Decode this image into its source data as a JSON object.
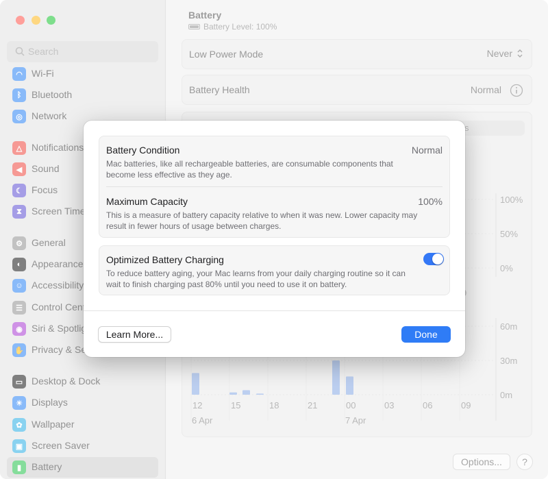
{
  "window": {
    "traffic_lights": [
      {
        "name": "close",
        "color": "#ff5f57"
      },
      {
        "name": "minimize",
        "color": "#febc2e"
      },
      {
        "name": "zoom",
        "color": "#28c840"
      }
    ]
  },
  "sidebar": {
    "search_placeholder": "Search",
    "items": [
      {
        "label": "Wi-Fi",
        "icon": "wifi-icon",
        "color": "#3b8cf5"
      },
      {
        "label": "Bluetooth",
        "icon": "bluetooth-icon",
        "color": "#3b8cf5"
      },
      {
        "label": "Network",
        "icon": "globe-icon",
        "color": "#3b8cf5"
      },
      {
        "label": "Notifications",
        "icon": "bell-icon",
        "color": "#f0564d"
      },
      {
        "label": "Sound",
        "icon": "speaker-icon",
        "color": "#f0564d"
      },
      {
        "label": "Focus",
        "icon": "moon-icon",
        "color": "#6a5cd6"
      },
      {
        "label": "Screen Time",
        "icon": "hourglass-icon",
        "color": "#6a5cd6"
      },
      {
        "label": "General",
        "icon": "gear-icon",
        "color": "#9a9a9a"
      },
      {
        "label": "Appearance",
        "icon": "appearance-icon",
        "color": "#2a2a2a"
      },
      {
        "label": "Accessibility",
        "icon": "accessibility-icon",
        "color": "#3b8cf5"
      },
      {
        "label": "Control Centre",
        "icon": "control-centre-icon",
        "color": "#9a9a9a"
      },
      {
        "label": "Siri & Spotlight",
        "icon": "siri-icon",
        "color": "#b04ad6"
      },
      {
        "label": "Privacy & Security",
        "icon": "hand-icon",
        "color": "#3b8cf5"
      },
      {
        "label": "Desktop & Dock",
        "icon": "dock-icon",
        "color": "#2a2a2a"
      },
      {
        "label": "Displays",
        "icon": "sun-icon",
        "color": "#3b8cf5"
      },
      {
        "label": "Wallpaper",
        "icon": "flower-icon",
        "color": "#3bb5e6"
      },
      {
        "label": "Screen Saver",
        "icon": "screen-saver-icon",
        "color": "#3bb5e6"
      },
      {
        "label": "Battery",
        "icon": "battery-icon",
        "color": "#34c759",
        "selected": true
      }
    ]
  },
  "main": {
    "title": "Battery",
    "battery_level": "Battery Level: 100%",
    "low_power_mode": {
      "label": "Low Power Mode",
      "value": "Never"
    },
    "battery_health": {
      "label": "Battery Health",
      "value": "Normal"
    },
    "segment_partial": "s",
    "options_label": "Options...",
    "help_label": "?"
  },
  "chart_data": [
    {
      "type": "line",
      "title": "",
      "y_tick_labels": [
        "100%",
        "50%",
        "0%"
      ],
      "ylim": [
        0,
        100
      ],
      "x_tick_labels": [
        "9"
      ],
      "values": []
    },
    {
      "type": "bar",
      "title": "",
      "y_tick_labels": [
        "60m",
        "30m",
        "0m"
      ],
      "ylim": [
        0,
        60
      ],
      "x_tick_labels": [
        "12",
        "15",
        "18",
        "21",
        "00",
        "03",
        "06",
        "09"
      ],
      "date_labels": [
        "6 Apr",
        "7 Apr"
      ],
      "values_minutes": [
        {
          "x": "12",
          "v": 19
        },
        {
          "x": "15a",
          "v": 2
        },
        {
          "x": "15b",
          "v": 4
        },
        {
          "x": "18",
          "v": 1
        },
        {
          "x": "00a",
          "v": 30
        },
        {
          "x": "00b",
          "v": 16
        }
      ]
    }
  ],
  "sheet": {
    "battery_condition": {
      "title": "Battery Condition",
      "value": "Normal",
      "description": "Mac batteries, like all rechargeable batteries, are consumable components that become less effective as they age."
    },
    "maximum_capacity": {
      "title": "Maximum Capacity",
      "value": "100%",
      "description": "This is a measure of battery capacity relative to when it was new. Lower capacity may result in fewer hours of usage between charges."
    },
    "optimized_charging": {
      "title": "Optimized Battery Charging",
      "enabled": true,
      "description": "To reduce battery aging, your Mac learns from your daily charging routine so it can wait to finish charging past 80% until you need to use it on battery."
    },
    "learn_more_label": "Learn More...",
    "done_label": "Done"
  }
}
